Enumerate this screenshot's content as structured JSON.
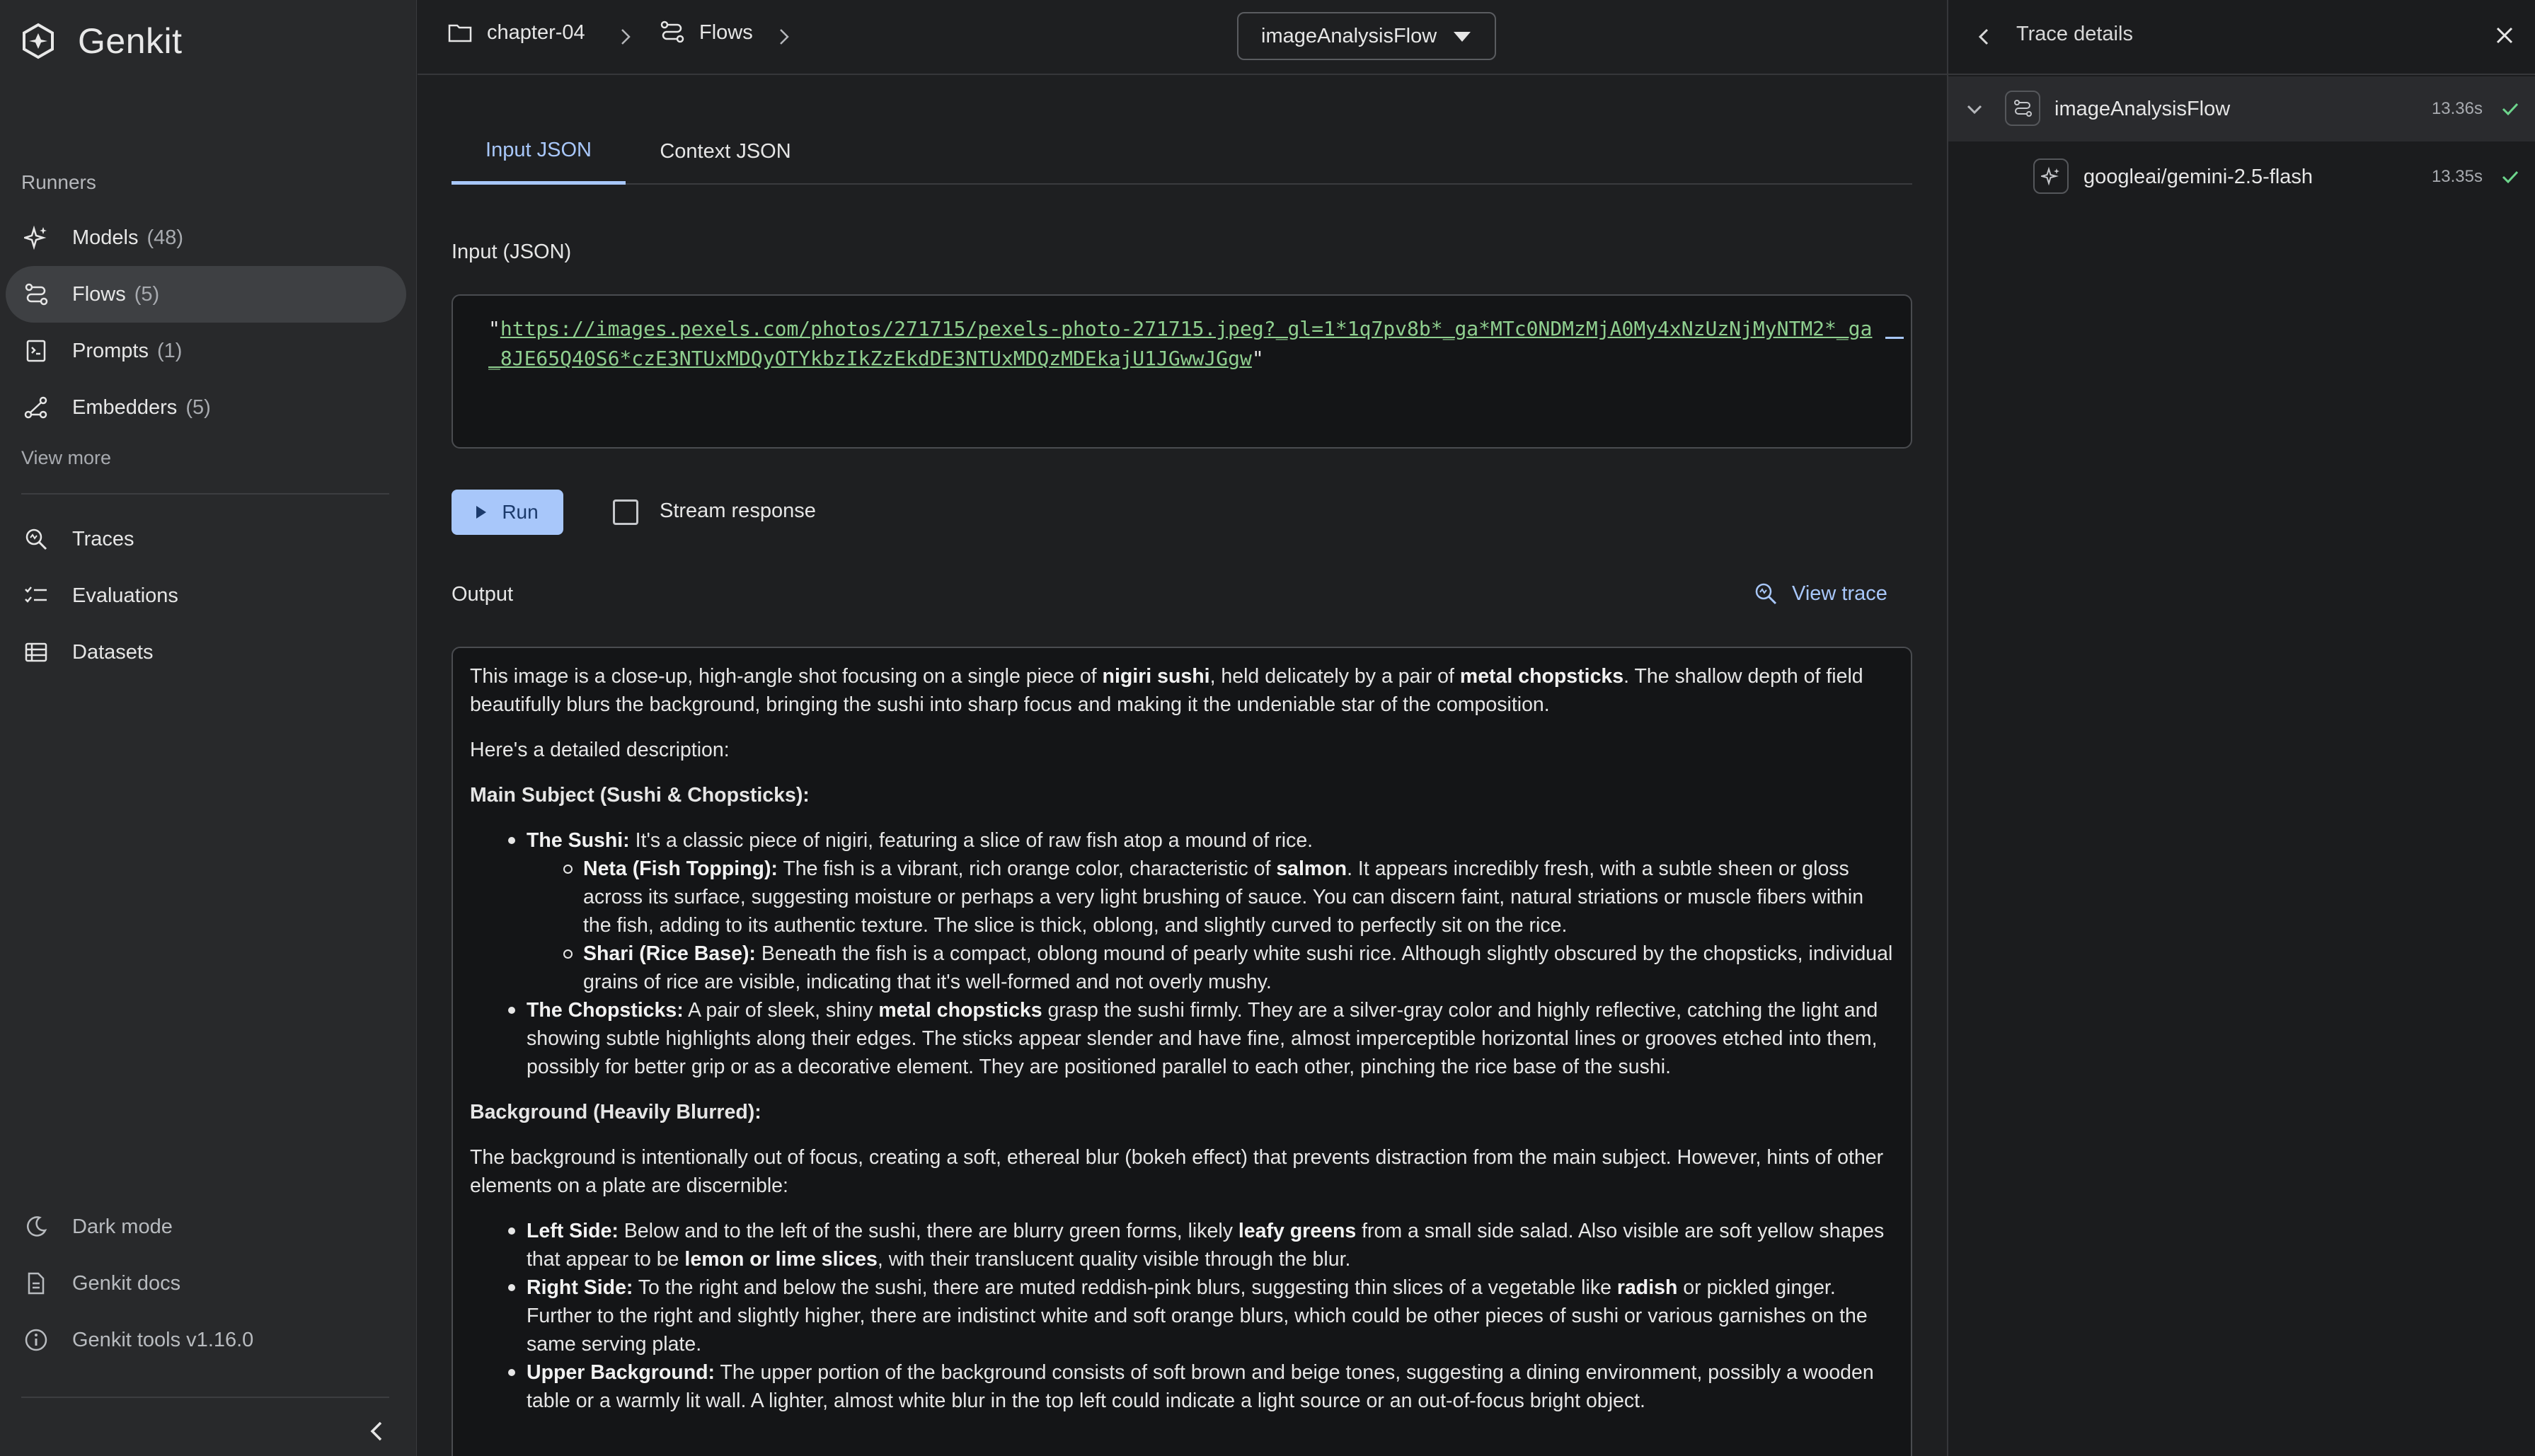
{
  "app": {
    "name": "Genkit"
  },
  "sidebar": {
    "section_label": "Runners",
    "runners": [
      {
        "label": "Models",
        "count": "(48)",
        "icon": "sparkle-icon"
      },
      {
        "label": "Flows",
        "count": "(5)",
        "icon": "flow-icon",
        "active": true
      },
      {
        "label": "Prompts",
        "count": "(1)",
        "icon": "prompt-icon"
      },
      {
        "label": "Embedders",
        "count": "(5)",
        "icon": "embedder-icon"
      }
    ],
    "view_more": "View more",
    "tools": [
      {
        "label": "Traces",
        "icon": "trace-search-icon"
      },
      {
        "label": "Evaluations",
        "icon": "checklist-icon"
      },
      {
        "label": "Datasets",
        "icon": "table-icon"
      }
    ],
    "bottom": [
      {
        "label": "Dark mode",
        "icon": "moon-icon"
      },
      {
        "label": "Genkit docs",
        "icon": "doc-icon"
      },
      {
        "label": "Genkit tools v1.16.0",
        "icon": "info-icon"
      }
    ]
  },
  "breadcrumb": {
    "project": "chapter-04",
    "section": "Flows",
    "flow": "imageAnalysisFlow"
  },
  "tabs": [
    "Input JSON",
    "Context JSON"
  ],
  "input": {
    "label": "Input (JSON)",
    "quote_open": "\"",
    "url": "https://images.pexels.com/photos/271715/pexels-photo-271715.jpeg?_gl=1*1q7pv8b*_ga*MTc0NDMzMjA0My4xNzUzNjMyNTM2*_ga_8JE65Q40S6*czE3NTUxMDQyOTYkbzIkZzEkdDE3NTUxMDQzMDEkajU1JGwwJGgw",
    "quote_close": "\""
  },
  "actions": {
    "run_label": "Run",
    "stream_label": "Stream response"
  },
  "output": {
    "label": "Output",
    "view_trace": "View trace",
    "p1_a": "This image is a close-up, high-angle shot focusing on a single piece of ",
    "p1_b": "nigiri sushi",
    "p1_c": ", held delicately by a pair of ",
    "p1_d": "metal chopsticks",
    "p1_e": ". The shallow depth of field beautifully blurs the background, bringing the sushi into sharp focus and making it the undeniable star of the composition.",
    "p2": "Here's a detailed description:",
    "h1": "Main Subject (Sushi & Chopsticks):",
    "sushi_label": "The Sushi:",
    "sushi_text": " It's a classic piece of nigiri, featuring a slice of raw fish atop a mound of rice.",
    "neta_label": "Neta (Fish Topping):",
    "neta_a": " The fish is a vibrant, rich orange color, characteristic of ",
    "neta_b": "salmon",
    "neta_c": ". It appears incredibly fresh, with a subtle sheen or gloss across its surface, suggesting moisture or perhaps a very light brushing of sauce. You can discern faint, natural striations or muscle fibers within the fish, adding to its authentic texture. The slice is thick, oblong, and slightly curved to perfectly sit on the rice.",
    "shari_label": "Shari (Rice Base):",
    "shari_text": " Beneath the fish is a compact, oblong mound of pearly white sushi rice. Although slightly obscured by the chopsticks, individual grains of rice are visible, indicating that it's well-formed and not overly mushy.",
    "chop_label": "The Chopsticks:",
    "chop_a": " A pair of sleek, shiny ",
    "chop_b": "metal chopsticks",
    "chop_c": " grasp the sushi firmly. They are a silver-gray color and highly reflective, catching the light and showing subtle highlights along their edges. The sticks appear slender and have fine, almost imperceptible horizontal lines or grooves etched into them, possibly for better grip or as a decorative element. They are positioned parallel to each other, pinching the rice base of the sushi.",
    "h2": "Background (Heavily Blurred):",
    "p3": "The background is intentionally out of focus, creating a soft, ethereal blur (bokeh effect) that prevents distraction from the main subject. However, hints of other elements on a plate are discernible:",
    "left_label": "Left Side:",
    "left_a": " Below and to the left of the sushi, there are blurry green forms, likely ",
    "left_b": "leafy greens",
    "left_c": " from a small side salad. Also visible are soft yellow shapes that appear to be ",
    "left_d": "lemon or lime slices",
    "left_e": ", with their translucent quality visible through the blur.",
    "right_label": "Right Side:",
    "right_a": " To the right and below the sushi, there are muted reddish-pink blurs, suggesting thin slices of a vegetable like ",
    "right_b": "radish",
    "right_c": " or pickled ginger. Further to the right and slightly higher, there are indistinct white and soft orange blurs, which could be other pieces of sushi or various garnishes on the same serving plate.",
    "upper_label": "Upper Background:",
    "upper_text": " The upper portion of the background consists of soft brown and beige tones, suggesting a dining environment, possibly a wooden table or a warmly lit wall. A lighter, almost white blur in the top left could indicate a light source or an out-of-focus bright object."
  },
  "trace_panel": {
    "title": "Trace details",
    "rows": [
      {
        "name": "imageAnalysisFlow",
        "time": "13.36s",
        "status": "success"
      },
      {
        "name": "googleai/gemini-2.5-flash",
        "time": "13.35s",
        "status": "success"
      }
    ]
  },
  "colors": {
    "accent": "#a8c7fa",
    "success": "#6dd58c",
    "link_green": "#8fcf8f"
  }
}
